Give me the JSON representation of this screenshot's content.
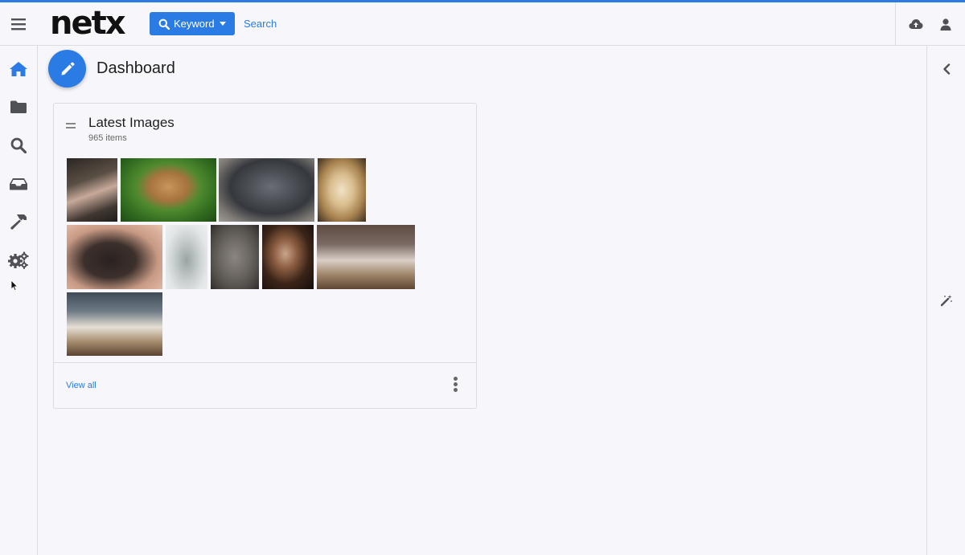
{
  "colors": {
    "accent": "#2b7be5",
    "background": "#f7f6fa",
    "border": "#dcdce0",
    "icon": "#505057"
  },
  "header": {
    "logo": "netx",
    "search_mode_label": "Keyword",
    "search_placeholder": "Search",
    "icons": [
      "menu-icon",
      "search-icon",
      "upload-cloud-icon",
      "user-icon"
    ]
  },
  "left_nav": [
    "home-icon",
    "folder-icon",
    "search-icon",
    "inbox-icon",
    "hammer-icon",
    "cogs-icon"
  ],
  "right_rail": [
    "chevron-left-icon",
    "magic-wand-icon"
  ],
  "page": {
    "title": "Dashboard"
  },
  "widget": {
    "title": "Latest Images",
    "count": "965 items",
    "view_all": "View all",
    "thumbnails": [
      "hand-holding-puppy-image",
      "tan-puppy-on-grass-image",
      "gray-pitbull-puppy-image",
      "golden-retriever-puppy-image",
      "black-labrador-puppy-image",
      "elephant-figurine-image",
      "gray-sleeping-dog-image",
      "dog-on-dark-background-image",
      "puppies-in-basket-image",
      "australian-shepherd-puppies-image"
    ]
  }
}
